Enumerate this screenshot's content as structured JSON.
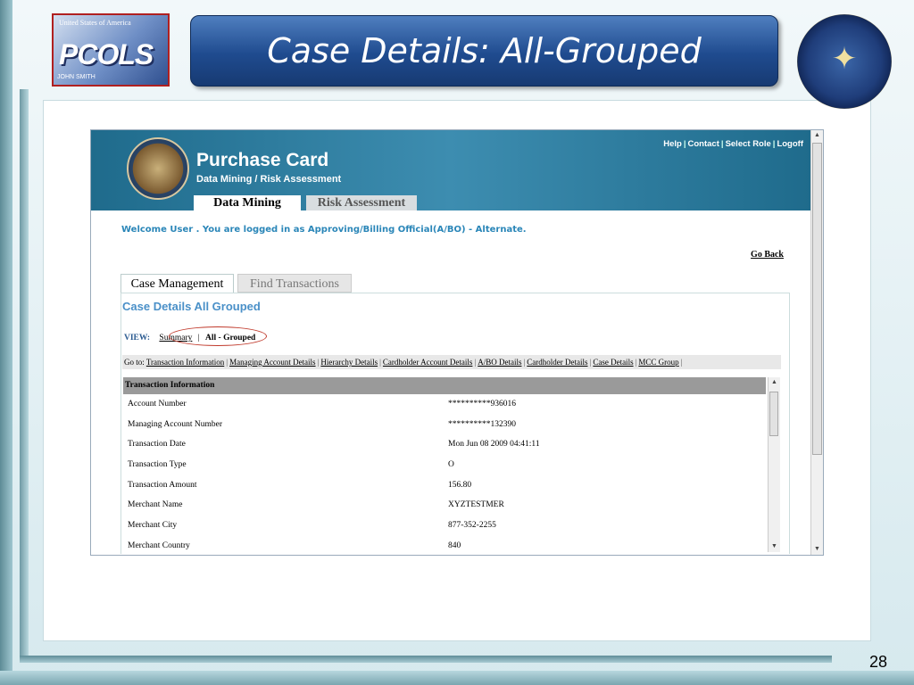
{
  "slide": {
    "title": "Case Details: All-Grouped",
    "page_number": "28"
  },
  "logo": {
    "flag_text": "United States of America",
    "wordmark": "PCOLS",
    "card_name": "JOHN SMITH"
  },
  "seal": {
    "icon": "dod-seal-icon"
  },
  "app": {
    "title": "Purchase Card",
    "subtitle": "Data Mining / Risk Assessment",
    "top_links": [
      "Help",
      "Contact",
      "Select Role",
      "Logoff"
    ],
    "tabs": [
      "Data Mining",
      "Risk Assessment"
    ],
    "welcome": "Welcome User . You are logged in as Approving/Billing Official(A/BO) - Alternate.",
    "go_back": "Go Back",
    "sub_tabs": [
      "Case Management",
      "Find Transactions"
    ],
    "case_heading": "Case Details All Grouped",
    "view": {
      "label": "VIEW:",
      "summary": "Summary",
      "separator": "|",
      "current": "All - Grouped"
    },
    "goto": {
      "label": "Go to:",
      "links": [
        "Transaction Information",
        "Managing Account Details",
        "Hierarchy Details",
        "Cardholder Account Details",
        "A/BO Details",
        "Cardholder Details",
        "Case Details",
        "MCC Group"
      ]
    },
    "transaction": {
      "header": "Transaction Information",
      "rows": [
        {
          "k": "Account Number",
          "v": "**********936016"
        },
        {
          "k": "Managing Account Number",
          "v": "**********132390"
        },
        {
          "k": "Transaction Date",
          "v": "Mon Jun 08 2009 04:41:11"
        },
        {
          "k": "Transaction Type",
          "v": "O"
        },
        {
          "k": "Transaction Amount",
          "v": "156.80"
        },
        {
          "k": "Merchant Name",
          "v": "XYZTESTMER"
        },
        {
          "k": "Merchant City",
          "v": "877-352-2255"
        },
        {
          "k": "Merchant Country",
          "v": "840"
        }
      ]
    }
  },
  "colors": {
    "banner": "#1f4b8f",
    "header": "#1f6b8c",
    "accent_link": "#4a90c8",
    "highlight_oval": "#c0392b"
  }
}
